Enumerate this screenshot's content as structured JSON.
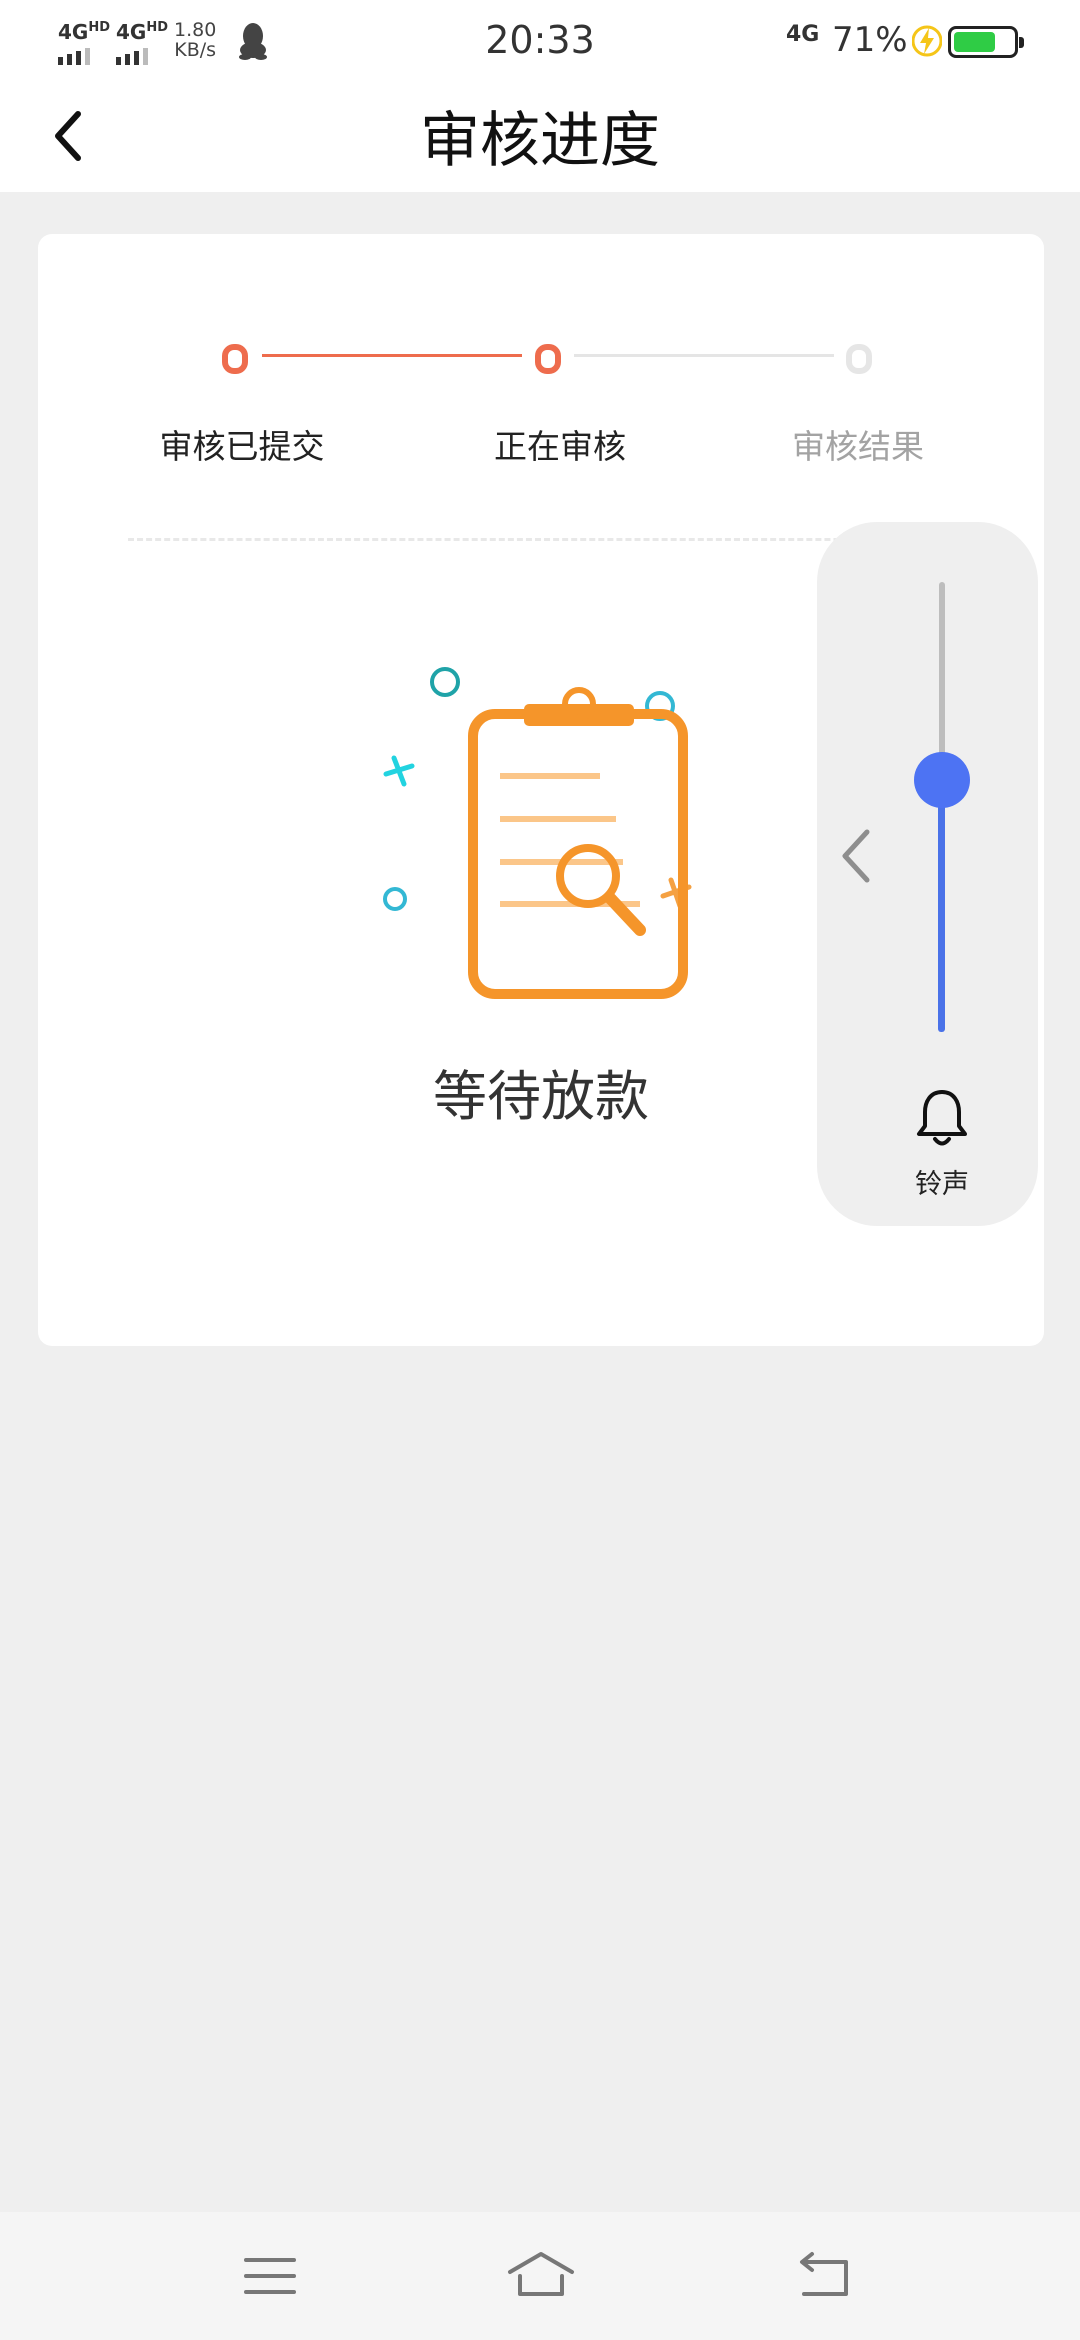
{
  "status_bar": {
    "sim1": "4G",
    "sim1_sup": "HD",
    "sim2": "4G",
    "sim2_sup": "HD",
    "speed_value": "1.80",
    "speed_unit": "KB/s",
    "time": "20:33",
    "network": "4G",
    "battery_percent": "71%",
    "battery_level": 0.71,
    "qq_icon": "qq-penguin-icon",
    "charging_icon": "lightning-bolt-icon",
    "battery_color": "#2fcc45"
  },
  "header": {
    "title": "审核进度",
    "back_icon": "chevron-left-icon"
  },
  "progress": {
    "steps": [
      {
        "label": "审核已提交",
        "state": "done"
      },
      {
        "label": "正在审核",
        "state": "current"
      },
      {
        "label": "审核结果",
        "state": "pending"
      }
    ],
    "active_color": "#ee6c4d",
    "inactive_color": "#e5e5e5"
  },
  "status": {
    "illustration_icon": "clipboard-search-icon",
    "text": "等待放款"
  },
  "volume_overlay": {
    "chevron_icon": "chevron-left-icon",
    "level": 0.6,
    "icon": "bell-icon",
    "label": "铃声",
    "accent_color": "#4d73f3"
  },
  "nav_bar": {
    "menu_icon": "menu-icon",
    "home_icon": "home-icon",
    "back_icon": "return-icon"
  }
}
